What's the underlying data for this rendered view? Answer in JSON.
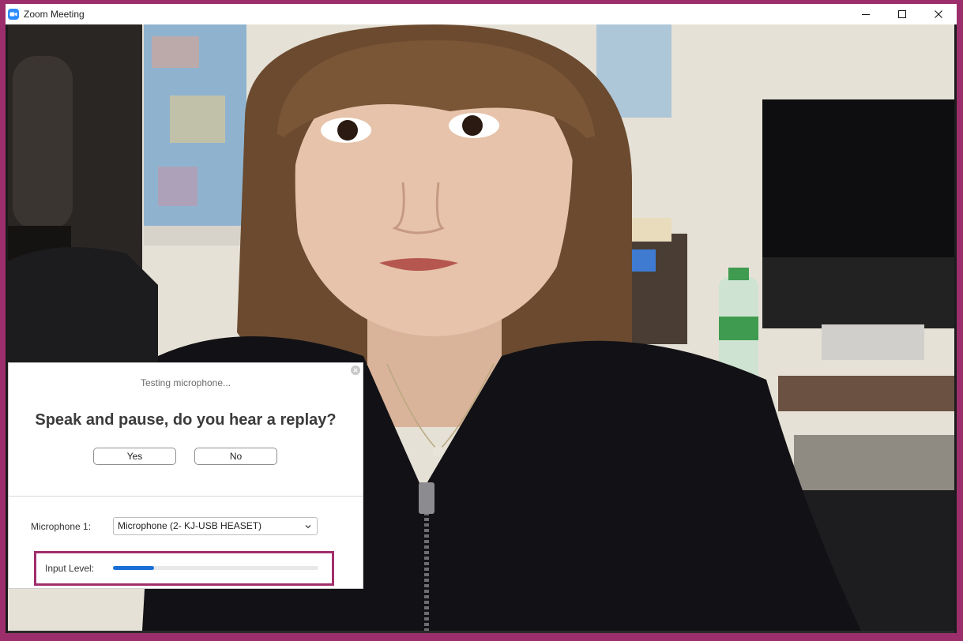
{
  "window": {
    "title": "Zoom Meeting",
    "app_icon": "zoom-camera-icon",
    "controls": [
      "minimize-icon",
      "maximize-icon",
      "close-icon"
    ]
  },
  "dialog": {
    "status": "Testing microphone...",
    "question": "Speak and pause, do you hear a replay?",
    "yes_label": "Yes",
    "no_label": "No",
    "microphone_label": "Microphone 1:",
    "microphone_selected": "Microphone (2- KJ-USB HEASET)",
    "input_level_label": "Input Level:",
    "input_level": 0.2
  },
  "colors": {
    "frame": "#9c2f6b",
    "highlight": "#a12f6c",
    "zoom_blue": "#2d8cff",
    "level_blue": "#1a6fd6"
  }
}
